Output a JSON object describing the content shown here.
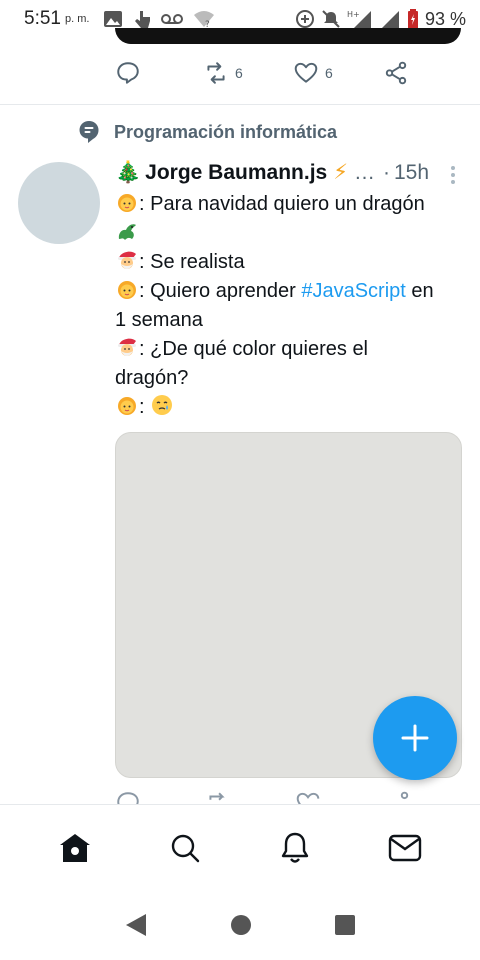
{
  "status_bar": {
    "time": "5:51",
    "ampm": "p. m.",
    "battery": "93 %"
  },
  "previous_tweet": {
    "retweets": "6",
    "likes": "6"
  },
  "topic": {
    "label": "Programación informática",
    "icon": "topic-bubble-icon"
  },
  "tweet": {
    "name": "Jorge Baumann.js",
    "name_prefix_emoji": "🎄",
    "bolt": "⚡",
    "truncation": "…",
    "separator": "·",
    "time": "15h",
    "lines": [
      {
        "speaker": "girl",
        "text": ": Para navidad quiero un dragón"
      },
      {
        "speaker": "dragon",
        "text": ""
      },
      {
        "speaker": "santa",
        "text": ": Se realista"
      },
      {
        "speaker": "girl",
        "text_before": ": Quiero aprender ",
        "hashtag": "#JavaScript",
        "text_after": " en"
      },
      {
        "speaker": "none",
        "text": "1 semana"
      },
      {
        "speaker": "santa",
        "text": ": ¿De qué color quieres el"
      },
      {
        "speaker": "none",
        "text": "dragón?"
      },
      {
        "speaker": "girl",
        "text": ": ",
        "end_emoji": "tear-face"
      }
    ]
  },
  "colors": {
    "accent": "#1d9bf0",
    "muted": "#536471",
    "avatar": "#cfd9de",
    "media": "#e1e1de"
  },
  "nav": {
    "items": [
      "home-icon",
      "search-icon",
      "notifications-icon",
      "messages-icon"
    ]
  }
}
